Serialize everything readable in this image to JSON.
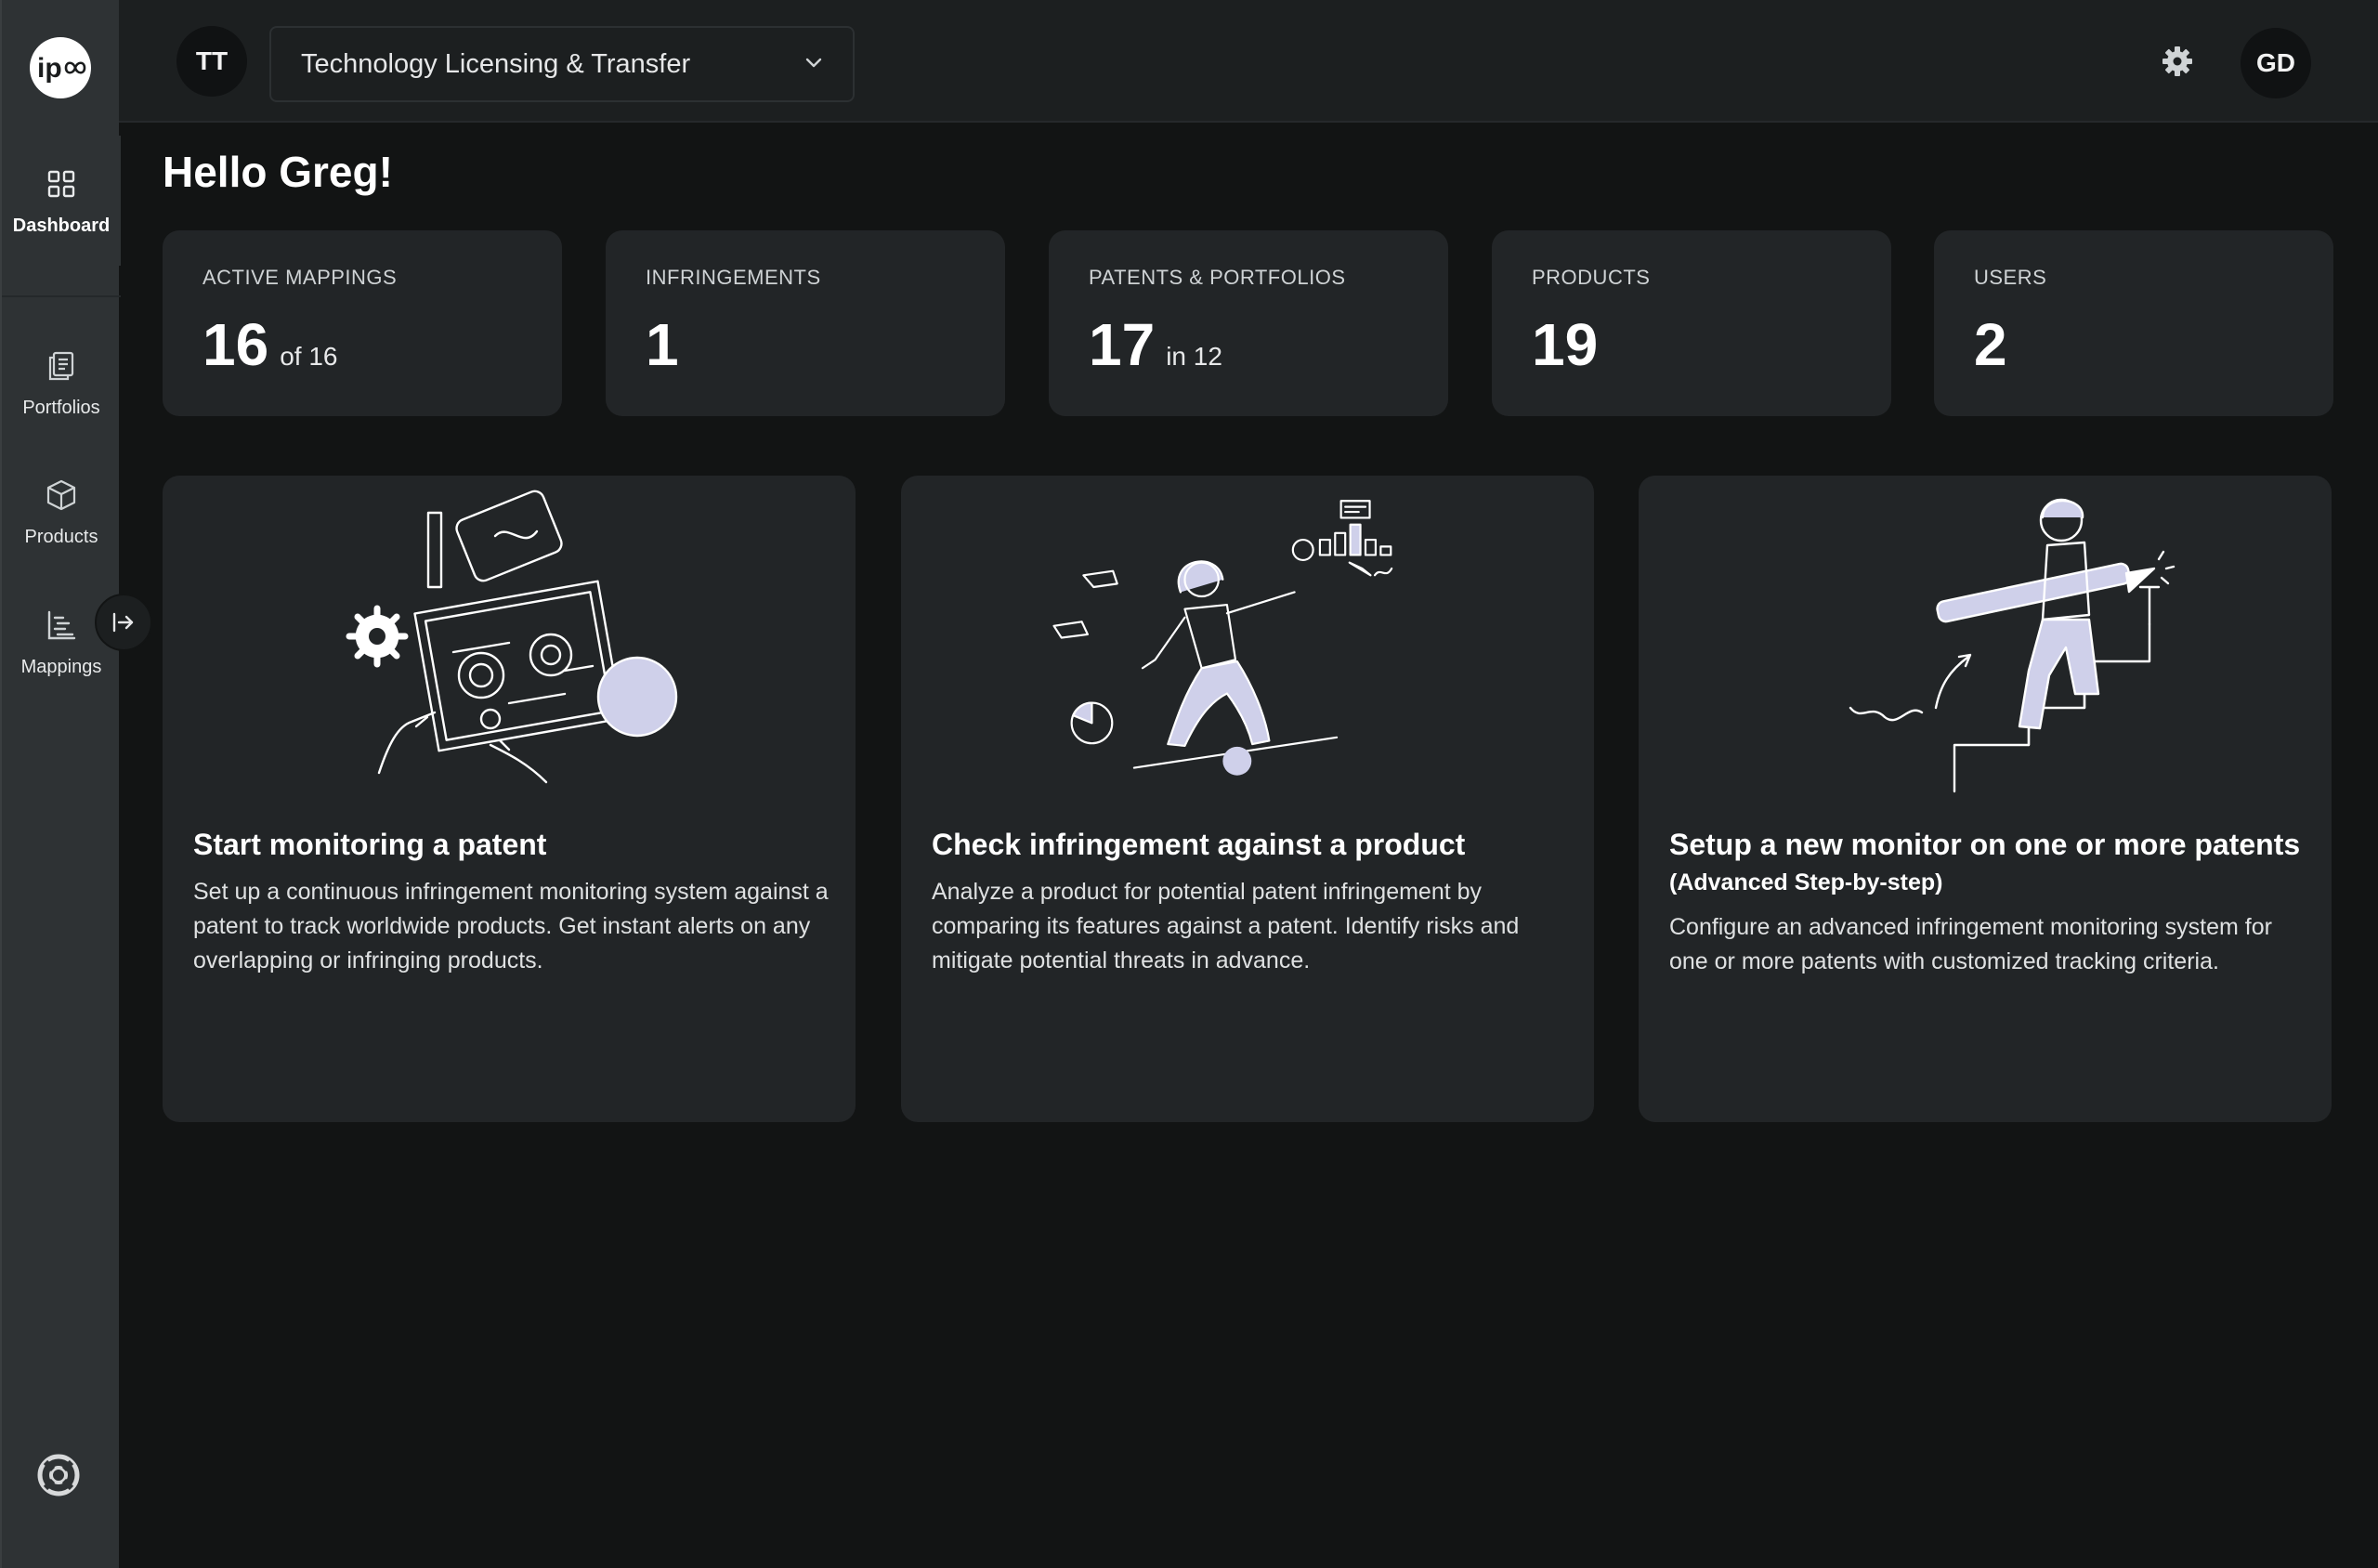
{
  "sidebar": {
    "logo_text": "ip",
    "items": [
      {
        "label": "Dashboard",
        "icon": "grid-icon",
        "active": true
      },
      {
        "label": "Portfolios",
        "icon": "documents-icon",
        "active": false
      },
      {
        "label": "Products",
        "icon": "box-icon",
        "active": false
      },
      {
        "label": "Mappings",
        "icon": "mappings-icon",
        "active": false
      }
    ],
    "collapse_icon": "expand-arrow-icon",
    "help_icon": "lifebuoy-icon"
  },
  "header": {
    "org_initials": "TT",
    "org_name": "Technology Licensing & Transfer",
    "settings_icon": "gear-icon",
    "user_initials": "GD"
  },
  "greeting": "Hello Greg!",
  "stats": [
    {
      "label": "ACTIVE MAPPINGS",
      "value": "16",
      "suffix": "of 16"
    },
    {
      "label": "INFRINGEMENTS",
      "value": "1",
      "suffix": ""
    },
    {
      "label": "PATENTS & PORTFOLIOS",
      "value": "17",
      "suffix": "in 12"
    },
    {
      "label": "PRODUCTS",
      "value": "19",
      "suffix": ""
    },
    {
      "label": "USERS",
      "value": "2",
      "suffix": ""
    }
  ],
  "actions": [
    {
      "title": "Start monitoring a patent",
      "title_suffix": "",
      "description": "Set up a continuous infringement monitoring system against a patent to track worldwide products. Get instant alerts on any overlapping or infringing products.",
      "illustration": "blueprint-gears-illustration"
    },
    {
      "title": "Check infringement against a product",
      "title_suffix": "",
      "description": "Analyze a product for potential patent infringement by comparing its features against a patent. Identify risks and mitigate potential threats in advance.",
      "illustration": "balancing-analyst-illustration"
    },
    {
      "title": "Setup a new monitor on one or more patents",
      "title_suffix": "(Advanced Step-by-step)",
      "description": "Configure an advanced infringement monitoring system for one or more patents with customized tracking criteria.",
      "illustration": "stairs-pencil-illustration"
    }
  ],
  "colors": {
    "background": "#121414",
    "sidebar": "#2e3234",
    "header": "#1c1f20",
    "card": "#222527",
    "illustration_fill": "#cfd0ea"
  }
}
